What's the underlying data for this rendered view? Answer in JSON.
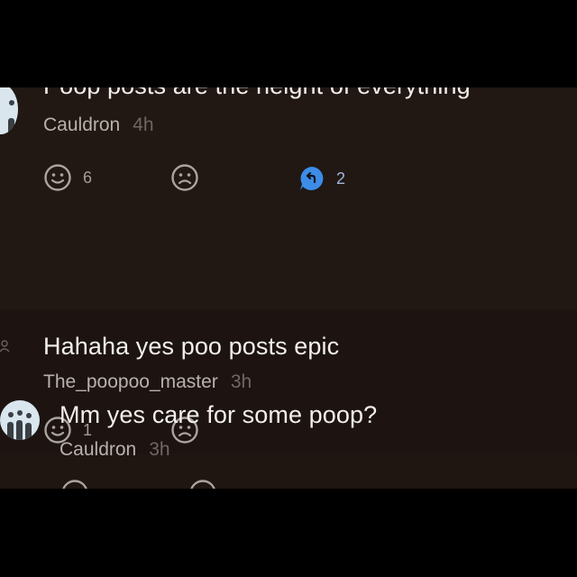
{
  "comments": [
    {
      "text": "Poop posts are the height of everything",
      "user": "Cauldron",
      "time": "4h",
      "likes": "6",
      "replies": "2"
    },
    {
      "text": "Hahaha yes poo posts epic",
      "user": "The_poopoo_master",
      "time": "3h",
      "likes": "1"
    },
    {
      "text": "Mm yes care for some poop?",
      "user": "Cauldron",
      "time": "3h"
    }
  ],
  "icons": {
    "like": "smile-icon",
    "dislike": "frown-icon",
    "reply": "reply-bubble-icon",
    "avatar": "avatar",
    "user_placeholder": "user-icon"
  },
  "colors": {
    "background": "#000000",
    "card": "#1f1511",
    "text": "#f2efed",
    "muted": "#b8b2ae",
    "accent": "#3d8ce8"
  }
}
